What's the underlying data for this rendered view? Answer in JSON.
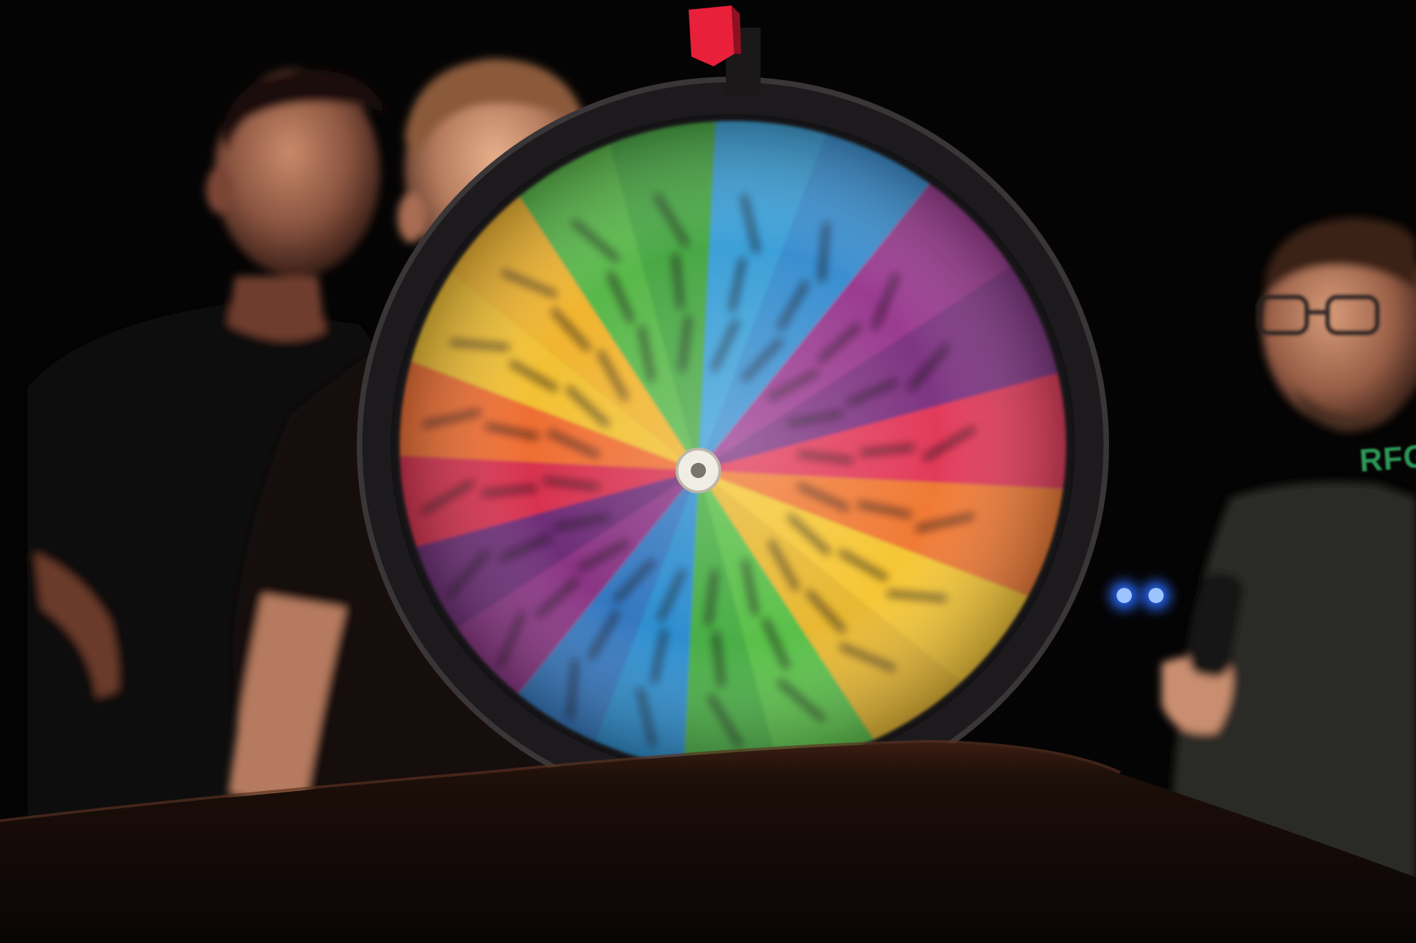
{
  "photo": {
    "background_color": "#050404",
    "stage_table_color": "#1a0d08",
    "pointer_color": "#e8203a",
    "shirt_print_text": "RFGH"
  },
  "wheel": {
    "segment_colors": [
      "#3ea0d8",
      "#3a8fd0",
      "#9a3a90",
      "#7e3482",
      "#e23a5a",
      "#f07a34",
      "#f5c634",
      "#e8b830",
      "#5ac04a",
      "#4aae44",
      "#2f8ecf",
      "#3478c0",
      "#8a3584",
      "#6e2e78",
      "#d8304f",
      "#ef6e30",
      "#f2c030",
      "#f0b42e",
      "#58b848",
      "#48a844"
    ],
    "hub_color": "#f0ede4",
    "rim_color": "#1c1a1d",
    "motion": "blurred"
  },
  "people": [
    {
      "role": "performer-left",
      "shirt_color": "#0e0c0c"
    },
    {
      "role": "performer-center",
      "shirt_color": "#120f0e"
    },
    {
      "role": "performer-right",
      "shirt_color": "#2a2a28",
      "glasses": true,
      "holds": "microphone"
    }
  ],
  "lights": [
    "blue-stage-light-pair"
  ]
}
